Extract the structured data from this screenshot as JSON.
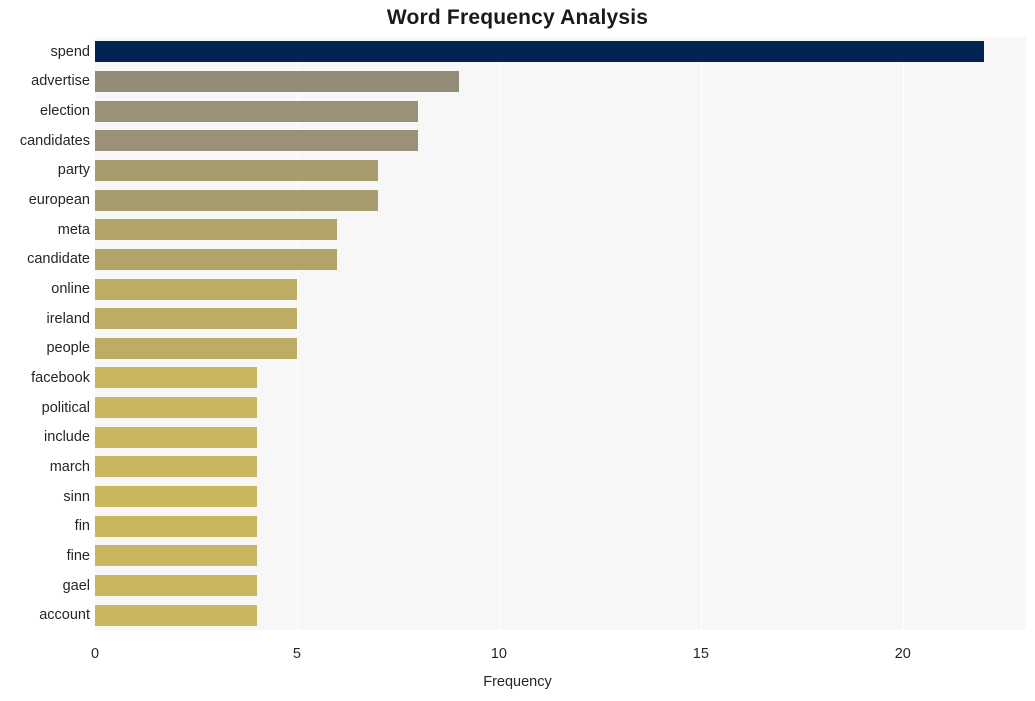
{
  "chart_data": {
    "type": "bar",
    "orientation": "horizontal",
    "title": "Word Frequency Analysis",
    "xlabel": "Frequency",
    "ylabel": "",
    "categories": [
      "spend",
      "advertise",
      "election",
      "candidates",
      "party",
      "european",
      "meta",
      "candidate",
      "online",
      "ireland",
      "people",
      "facebook",
      "political",
      "include",
      "march",
      "sinn",
      "fin",
      "fine",
      "gael",
      "account"
    ],
    "values": [
      22,
      9,
      8,
      8,
      7,
      7,
      6,
      6,
      5,
      5,
      5,
      4,
      4,
      4,
      4,
      4,
      4,
      4,
      4,
      4
    ],
    "bar_colors": [
      "#032450",
      "#938c78",
      "#9b9179",
      "#9b9179",
      "#a79c6d",
      "#a79c6d",
      "#b2a469",
      "#b2a469",
      "#bcac64",
      "#bcac64",
      "#bcac64",
      "#c9b75f",
      "#c9b75f",
      "#c9b75f",
      "#c9b75f",
      "#c9b75f",
      "#c9b75f",
      "#c9b75f",
      "#c9b75f",
      "#c9b75f"
    ],
    "xlim": [
      0,
      23.05
    ],
    "xticks": [
      0,
      5,
      10,
      15,
      20
    ],
    "xtick_labels": [
      "0",
      "5",
      "10",
      "15",
      "20"
    ],
    "gridlines": {
      "vertical": true,
      "horizontal": false,
      "color": "#ffffff"
    },
    "plot_background": "#f7f7f7",
    "figure_background": "#ffffff",
    "legend": null
  }
}
